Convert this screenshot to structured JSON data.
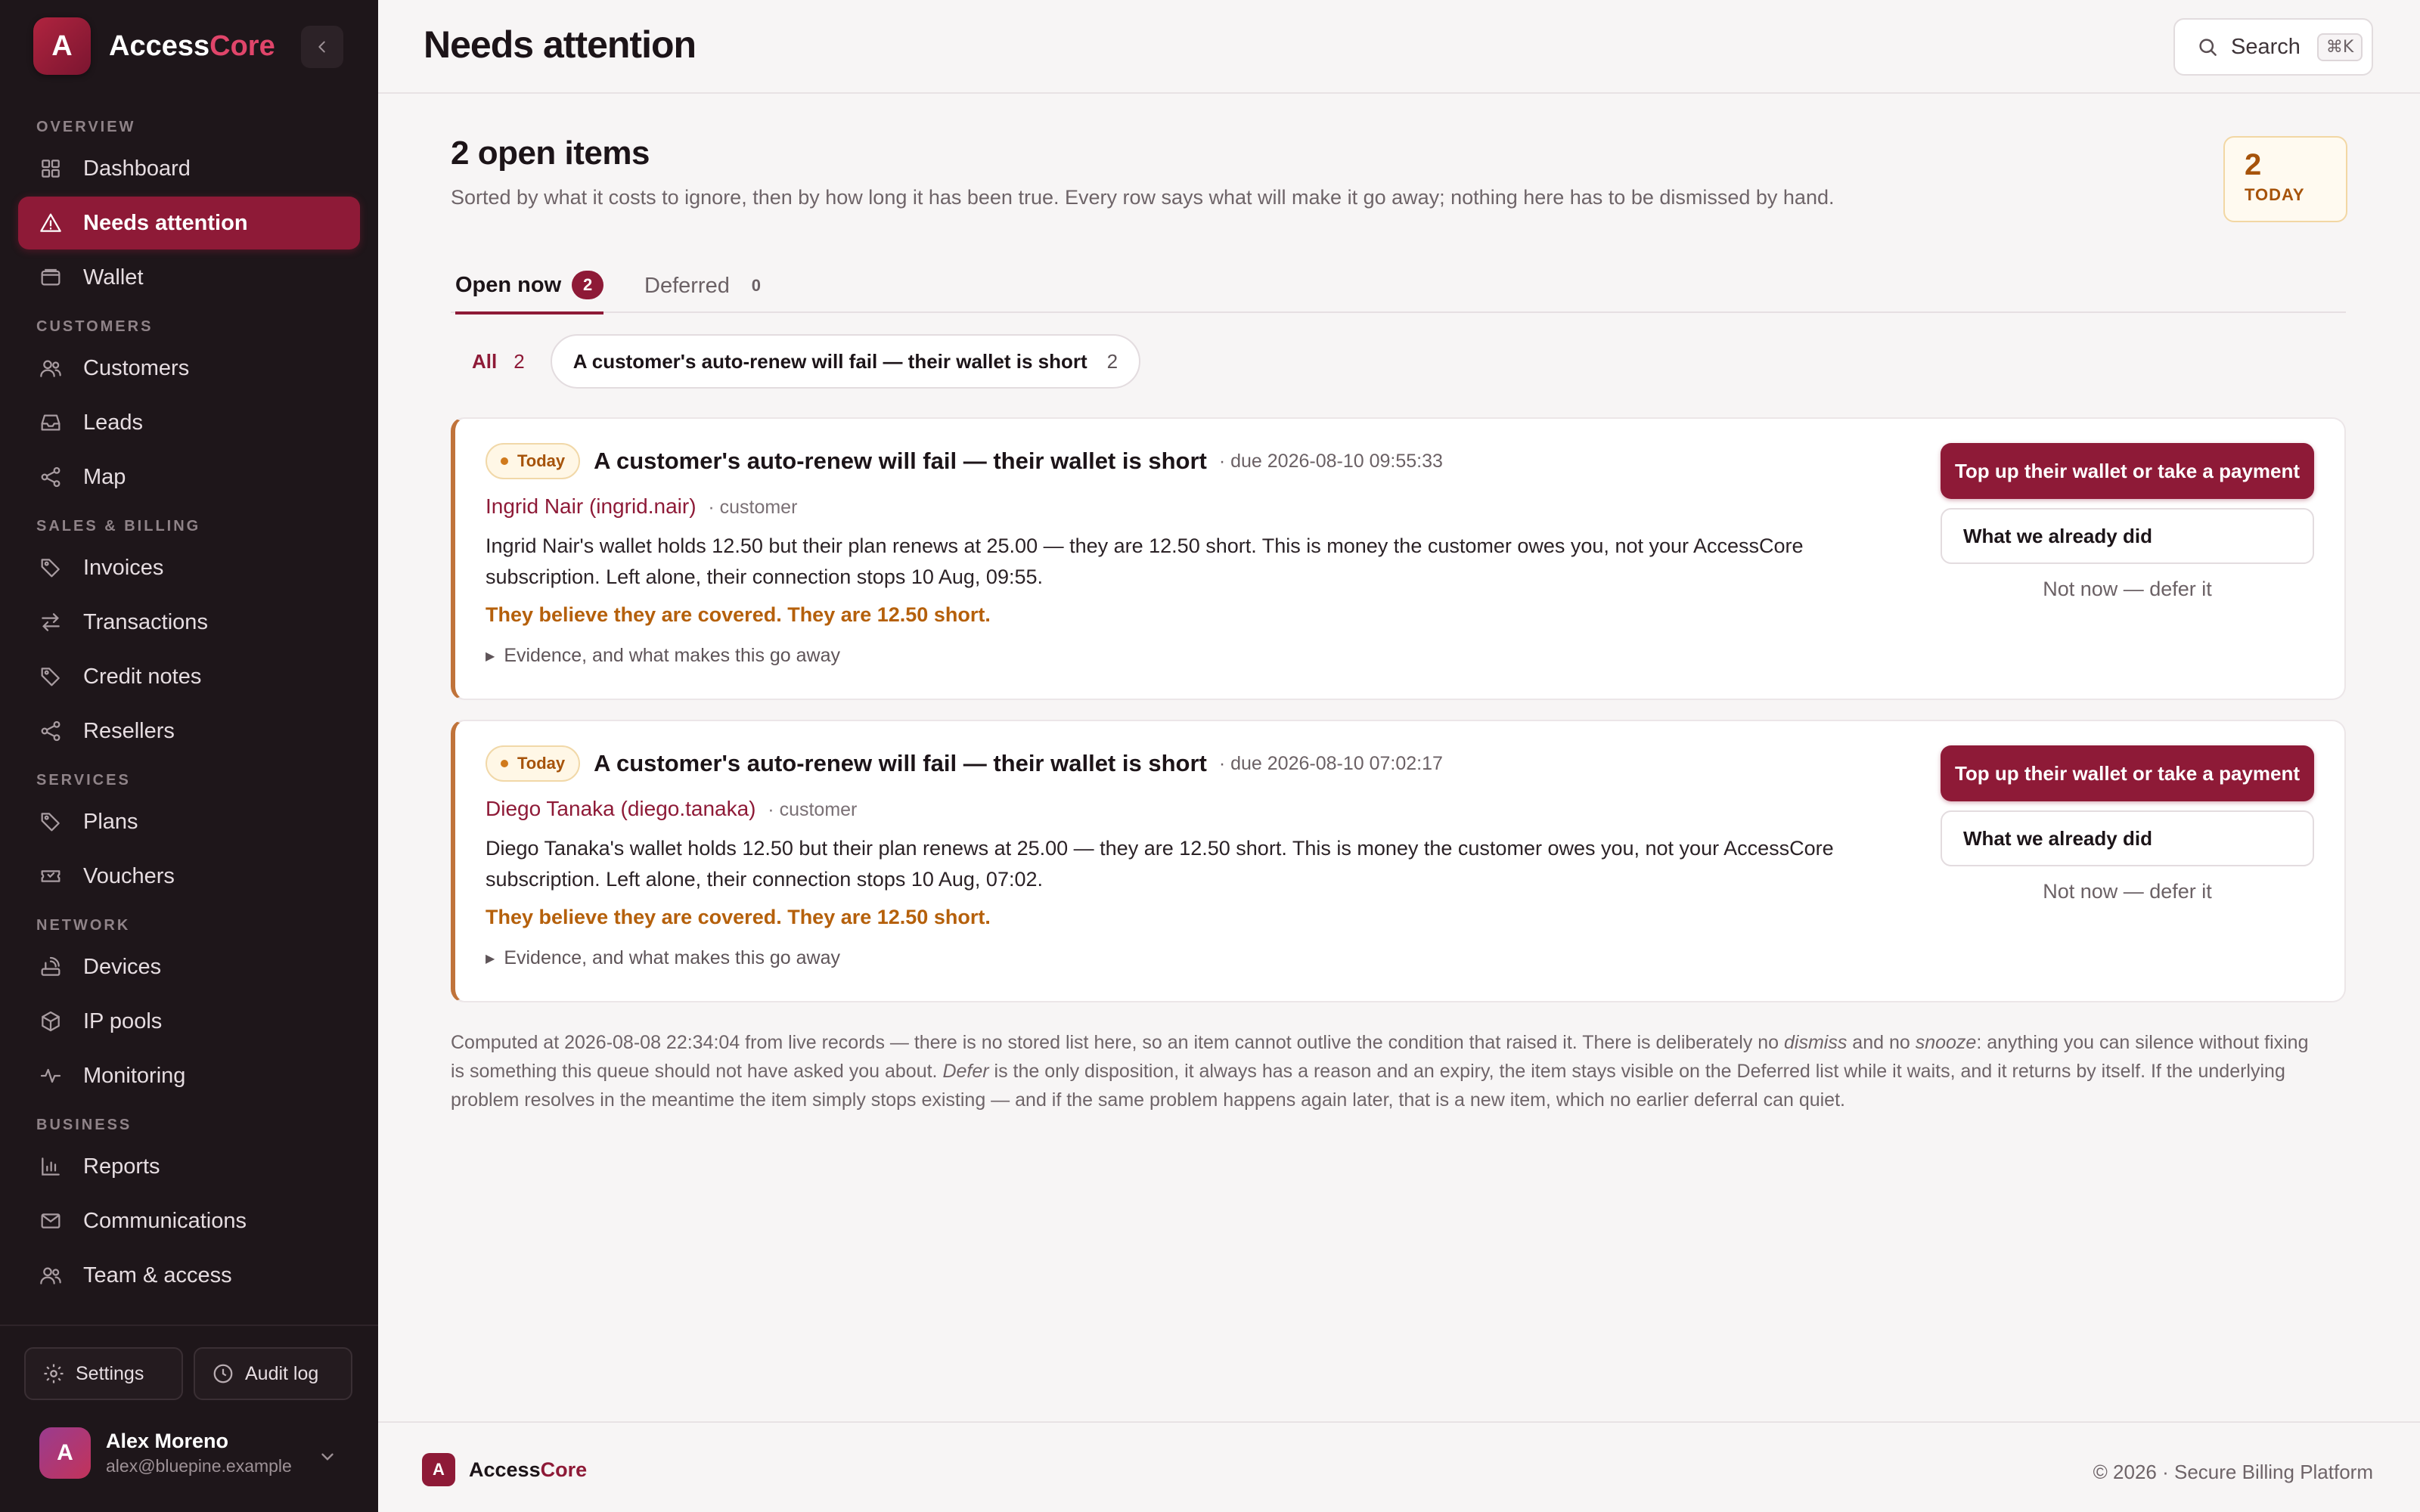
{
  "app": {
    "name_prefix": "Access",
    "name_accent": "Core",
    "logo_letter": "A",
    "collapse_icon": "chevron-left-icon"
  },
  "sidebar": {
    "sections": [
      {
        "label": "OVERVIEW",
        "items": [
          {
            "label": "Dashboard",
            "icon": "grid-icon"
          },
          {
            "label": "Needs attention",
            "icon": "warning-icon",
            "active": true
          },
          {
            "label": "Wallet",
            "icon": "wallet-icon"
          }
        ]
      },
      {
        "label": "CUSTOMERS",
        "items": [
          {
            "label": "Customers",
            "icon": "users-icon"
          },
          {
            "label": "Leads",
            "icon": "inbox-icon"
          },
          {
            "label": "Map",
            "icon": "share-icon"
          }
        ]
      },
      {
        "label": "SALES & BILLING",
        "items": [
          {
            "label": "Invoices",
            "icon": "tag-icon"
          },
          {
            "label": "Transactions",
            "icon": "arrows-icon"
          },
          {
            "label": "Credit notes",
            "icon": "tag-icon"
          },
          {
            "label": "Resellers",
            "icon": "share-icon"
          }
        ]
      },
      {
        "label": "SERVICES",
        "items": [
          {
            "label": "Plans",
            "icon": "tag-icon"
          },
          {
            "label": "Vouchers",
            "icon": "ticket-icon"
          }
        ]
      },
      {
        "label": "NETWORK",
        "items": [
          {
            "label": "Devices",
            "icon": "router-icon"
          },
          {
            "label": "IP pools",
            "icon": "cube-icon"
          },
          {
            "label": "Monitoring",
            "icon": "pulse-icon"
          }
        ]
      },
      {
        "label": "BUSINESS",
        "items": [
          {
            "label": "Reports",
            "icon": "bar-chart-icon"
          },
          {
            "label": "Communications",
            "icon": "mail-icon"
          },
          {
            "label": "Team & access",
            "icon": "users-icon"
          }
        ]
      }
    ],
    "settings_label": "Settings",
    "audit_label": "Audit log",
    "user": {
      "initial": "A",
      "name": "Alex Moreno",
      "email": "alex@bluepine.example"
    }
  },
  "header": {
    "title": "Needs attention",
    "search_label": "Search",
    "search_shortcut": "⌘K"
  },
  "summary": {
    "title": "2 open items",
    "subtitle": "Sorted by what it costs to ignore, then by how long it has been true. Every row says what will make it go away; nothing here has to be dismissed by hand.",
    "today_count": "2",
    "today_label": "TODAY"
  },
  "tabs": [
    {
      "label": "Open now",
      "count": "2",
      "active": true
    },
    {
      "label": "Deferred",
      "count": "0",
      "active": false
    }
  ],
  "filters": {
    "all_label": "All",
    "all_count": "2",
    "category_label": "A customer's auto-renew will fail — their wallet is short",
    "category_count": "2"
  },
  "items": [
    {
      "badge": "Today",
      "title": "A customer's auto-renew will fail — their wallet is short",
      "due": "· due 2026-08-10 09:55:33",
      "customer": "Ingrid Nair (ingrid.nair)",
      "role": "· customer",
      "description": "Ingrid Nair's wallet holds 12.50 but their plan renews at 25.00 — they are 12.50 short. This is money the customer owes you, not your AccessCore subscription. Left alone, their connection stops 10 Aug, 09:55.",
      "warning": "They believe they are covered. They are 12.50 short.",
      "evidence": "Evidence, and what makes this go away",
      "primary_action": "Top up their wallet or take a payment",
      "secondary_action": "What we already did",
      "defer_action": "Not now — defer it"
    },
    {
      "badge": "Today",
      "title": "A customer's auto-renew will fail — their wallet is short",
      "due": "· due 2026-08-10 07:02:17",
      "customer": "Diego Tanaka (diego.tanaka)",
      "role": "· customer",
      "description": "Diego Tanaka's wallet holds 12.50 but their plan renews at 25.00 — they are 12.50 short. This is money the customer owes you, not your AccessCore subscription. Left alone, their connection stops 10 Aug, 07:02.",
      "warning": "They believe they are covered. They are 12.50 short.",
      "evidence": "Evidence, and what makes this go away",
      "primary_action": "Top up their wallet or take a payment",
      "secondary_action": "What we already did",
      "defer_action": "Not now — defer it"
    }
  ],
  "footnote": {
    "p1": "Computed at 2026-08-08 22:34:04 from live records — there is no stored list here, so an item cannot outlive the condition that raised it. There is deliberately no ",
    "em1": "dismiss",
    "p2": " and no ",
    "em2": "snooze",
    "p3": ": anything you can silence without fixing is something this queue should not have asked you about. ",
    "em3": "Defer",
    "p4": " is the only disposition, it always has a reason and an expiry, the item stays visible on the Deferred list while it waits, and it returns by itself. If the underlying problem resolves in the meantime the item simply stops existing — and if the same problem happens again later, that is a new item, which no earlier deferral can quiet."
  },
  "footer": {
    "logo_letter": "A",
    "name_prefix": "Access",
    "name_accent": "Core",
    "copyright": "© 2026 · Secure Billing Platform"
  },
  "colors": {
    "brand": "#8e1a37",
    "sidebar_bg": "#1e161a",
    "warning": "#b5600b",
    "card_accent": "#c0733a"
  }
}
